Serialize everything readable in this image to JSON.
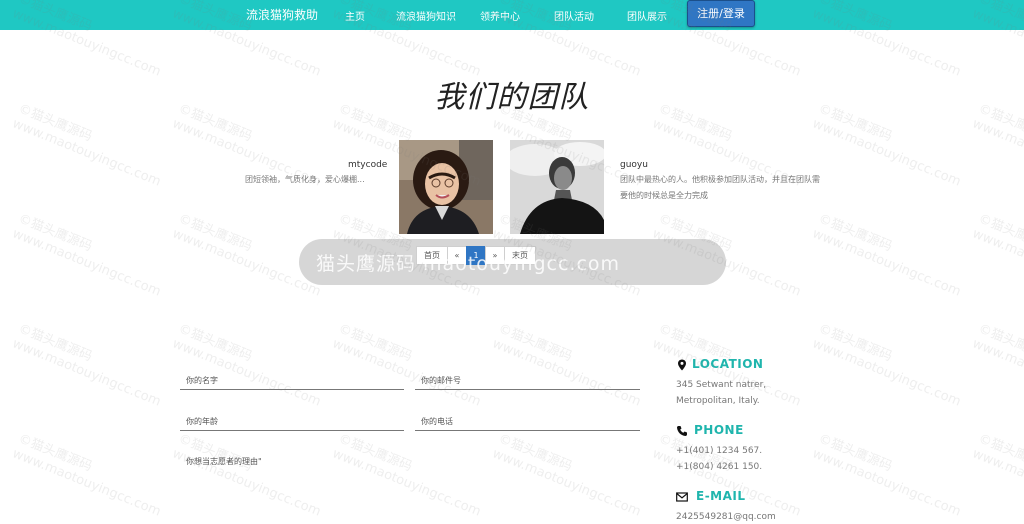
{
  "nav": {
    "brand": "流浪猫狗救助",
    "links": [
      "主页",
      "流浪猫狗知识",
      "领养中心",
      "团队活动",
      "团队展示"
    ],
    "register_label": "注册/登录"
  },
  "team": {
    "title": "我们的团队",
    "members": [
      {
        "name": "mtycode",
        "desc": "团短领袖，气质化身，爱心爆棚..."
      },
      {
        "name": "guoyu",
        "desc": "团队中最热心的人。他积极参加团队活动，并且在团队需要他的时候总是全力完成"
      }
    ]
  },
  "pagination": {
    "first": "首页",
    "prev": "«",
    "current": "1",
    "next": "»",
    "last": "末页",
    "overlay_text": "猫头鹰源码 maotouyingcc.com"
  },
  "form": {
    "name_placeholder": "你的名字",
    "email_placeholder": "你的邮件号",
    "age_placeholder": "你的年龄",
    "phone_placeholder": "你的电话",
    "reason_placeholder": "你想当志愿者的理由\""
  },
  "contact": {
    "location": {
      "title": "LOCATION",
      "lines": [
        "345 Setwant natrer,",
        "Metropolitan, Italy."
      ]
    },
    "phone": {
      "title": "PHONE",
      "lines": [
        "+1(401) 1234 567.",
        "+1(804) 4261 150."
      ]
    },
    "email": {
      "title": "E-MAIL",
      "lines": [
        "2425549281@qq.com"
      ]
    }
  },
  "watermark": {
    "line1": "©猫头鹰源码",
    "line2": "www.maotouyingcc.com"
  },
  "colors": {
    "nav_bg": "#1fc8c3",
    "accent": "#1fb5ad",
    "button": "#2f76c4"
  }
}
